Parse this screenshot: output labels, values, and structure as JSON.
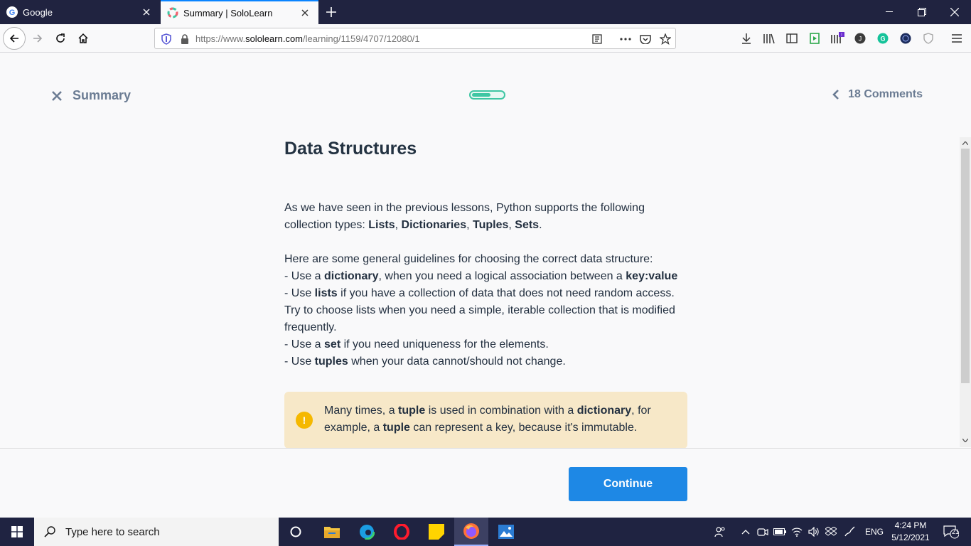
{
  "browser": {
    "tabs": [
      {
        "title": "Google",
        "active": false
      },
      {
        "title": "Summary | SoloLearn",
        "active": true
      }
    ],
    "url": {
      "prefix": "https://www.",
      "host": "sololearn.com",
      "path": "/learning/1159/4707/12080/1"
    }
  },
  "page": {
    "close_label": "Summary",
    "progress_fraction": 0.6,
    "comments_label": "18 Comments",
    "title": "Data Structures",
    "intro": {
      "t1": "As we have seen in the previous lessons, Python supports the following collection types: ",
      "lists": "Lists",
      "sep1": ", ",
      "dictionaries": "Dictionaries",
      "sep2": ", ",
      "tuples": "Tuples",
      "sep3": ", ",
      "sets": "Sets",
      "end": "."
    },
    "guidelines": {
      "heading": "Here are some general guidelines for choosing the correct data structure:",
      "g1_a": "- Use a ",
      "g1_b": "dictionary",
      "g1_c": ", when you need a logical association between a ",
      "g1_d": "key:value",
      "g2_a": "- Use ",
      "g2_b": "lists",
      "g2_c": " if you have a collection of data that does not need random access. Try to choose lists when you need a simple, iterable collection that is modified frequently.",
      "g3_a": "- Use a ",
      "g3_b": "set",
      "g3_c": " if you need uniqueness for the elements.",
      "g4_a": "- Use ",
      "g4_b": "tuples",
      "g4_c": " when your data cannot/should not change."
    },
    "note": {
      "icon": "!",
      "n1": "Many times, a ",
      "n2": "tuple",
      "n3": " is used in combination with a ",
      "n4": "dictionary",
      "n5": ", for example, a ",
      "n6": "tuple",
      "n7": " can represent a key, because it's immutable."
    },
    "continue_label": "Continue"
  },
  "taskbar": {
    "search_placeholder": "Type here to search",
    "language": "ENG",
    "time": "4:24 PM",
    "date": "5/12/2021",
    "notification_count": "21"
  },
  "colors": {
    "accent": "#1e88e5",
    "progress": "#3ec6a3",
    "note_bg": "#f7e8c8",
    "note_icon": "#f5b800",
    "tabbar": "#202340"
  },
  "icons": [
    "google-icon",
    "sololearn-icon",
    "close-tab-icon",
    "plus-icon",
    "minimize-icon",
    "restore-icon",
    "window-close-icon",
    "back-arrow-icon",
    "forward-arrow-icon",
    "reload-icon",
    "home-icon",
    "shield-icon",
    "lock-icon",
    "reader-view-icon",
    "more-icon",
    "pocket-icon",
    "star-icon",
    "download-icon",
    "library-icon",
    "sidebar-icon",
    "hamburger-menu-icon",
    "windows-start-icon",
    "search-icon",
    "cortana-icon",
    "file-explorer-icon",
    "edge-icon",
    "opera-icon",
    "sticky-notes-icon",
    "firefox-icon",
    "photos-icon"
  ]
}
